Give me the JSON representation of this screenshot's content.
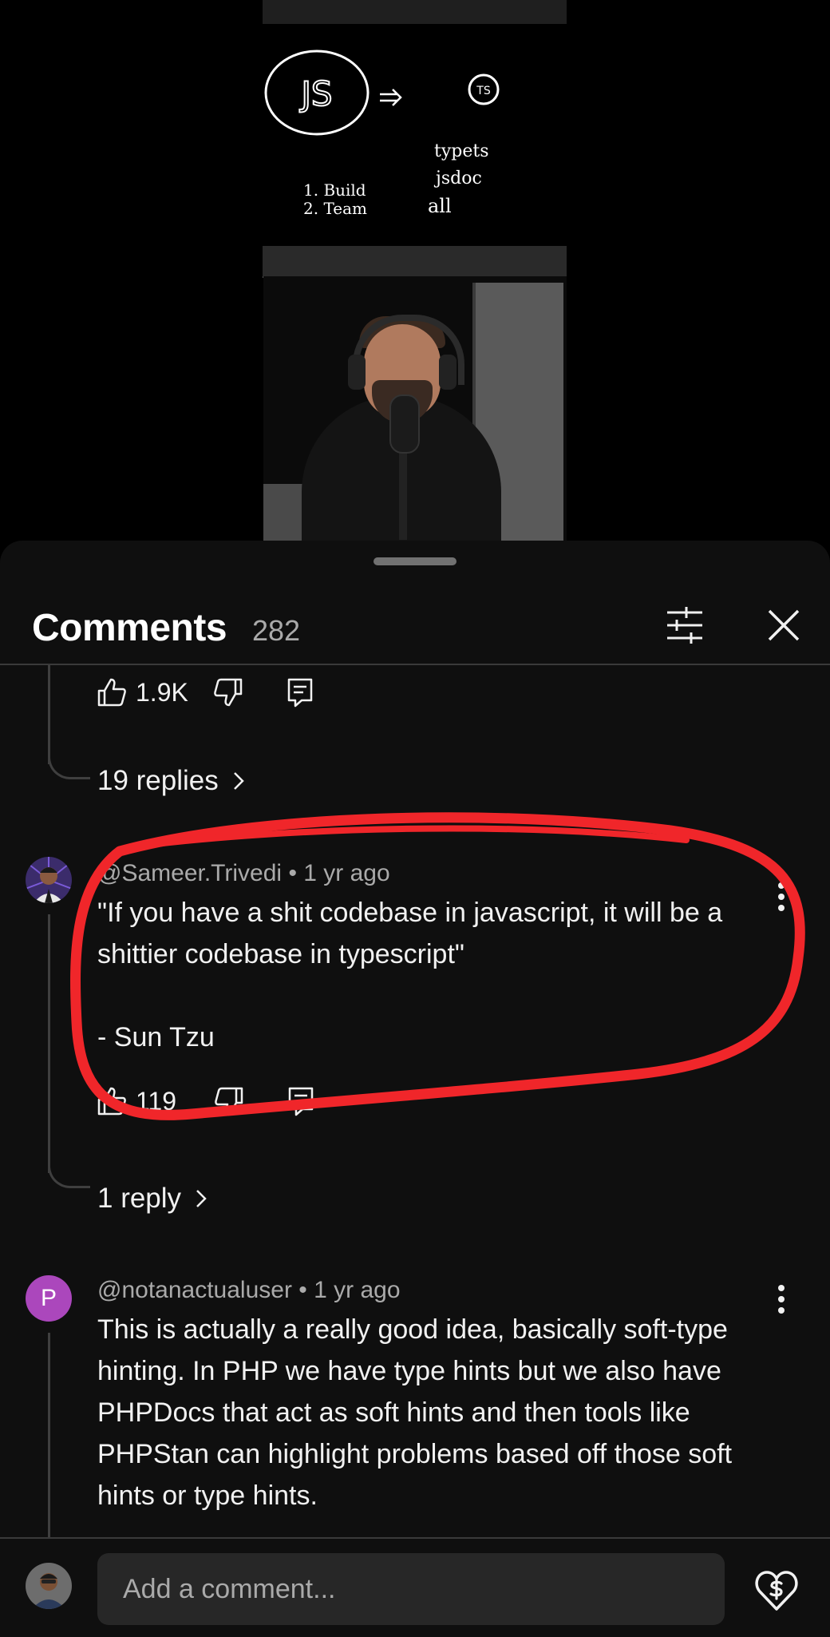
{
  "sheet": {
    "title": "Comments",
    "count": "282"
  },
  "whiteboard": {
    "logo_js": "JS",
    "logo_ts": "TS",
    "item1": "1. Build",
    "item2": "2. Team",
    "opt1": "typets",
    "opt2": "jsdoc",
    "opt3": "all"
  },
  "comments": [
    {
      "likes": "1.9K",
      "replies_label": "19 replies"
    },
    {
      "author": "@Sameer.Trivedi",
      "time": "1 yr ago",
      "text": "\"If you have a shit codebase in javascript, it will be a shittier codebase in typescript\"\n\n- Sun Tzu",
      "likes": "119",
      "replies_label": "1 reply"
    },
    {
      "author": "@notanactualuser",
      "avatar_letter": "P",
      "time": "1 yr ago",
      "text": "This is actually a really good idea, basically soft-type hinting. In PHP we have type hints but we also have PHPDocs that act as soft hints and then tools like PHPStan can highlight problems based off those soft hints or type hints."
    }
  ],
  "composer": {
    "placeholder": "Add a comment..."
  },
  "colors": {
    "annotation": "#f0262a",
    "avatar_p": "#ab47bc",
    "sheet_bg": "#0f0f0f"
  }
}
